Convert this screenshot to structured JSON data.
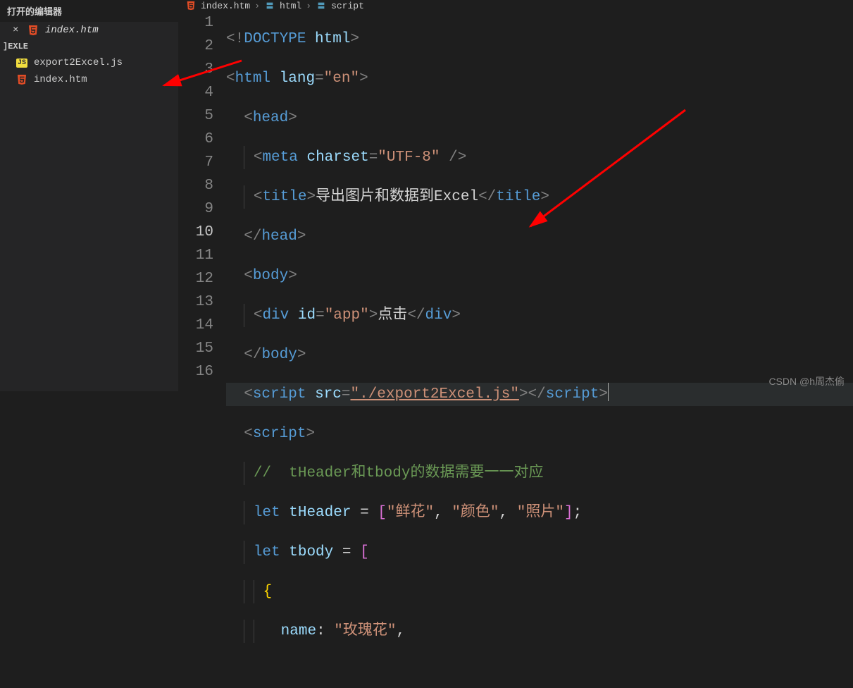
{
  "sidebar": {
    "open_editors_header": "打开的编辑器",
    "open_file": {
      "label": "index.htm"
    },
    "workspace": "]EXLE",
    "files": [
      {
        "icon": "js",
        "label": "export2Excel.js"
      },
      {
        "icon": "html5",
        "label": "index.htm"
      }
    ]
  },
  "breadcrumb": {
    "items": [
      {
        "icon": "html5",
        "label": "index.htm"
      },
      {
        "icon": "block",
        "label": "html"
      },
      {
        "icon": "block",
        "label": "script"
      }
    ]
  },
  "editor": {
    "active_line": 10,
    "line_numbers": [
      "1",
      "2",
      "3",
      "4",
      "5",
      "6",
      "7",
      "8",
      "9",
      "10",
      "11",
      "12",
      "13",
      "14",
      "15",
      "16"
    ],
    "code": {
      "l1": {
        "doctype": "DOCTYPE",
        "html": "html"
      },
      "l2": {
        "tag": "html",
        "attr": "lang",
        "val": "\"en\""
      },
      "l3": {
        "tag": "head"
      },
      "l4": {
        "tag": "meta",
        "attr": "charset",
        "val": "\"UTF-8\""
      },
      "l5": {
        "tag": "title",
        "text": "导出图片和数据到Excel"
      },
      "l6": {
        "tag": "head"
      },
      "l7": {
        "tag": "body"
      },
      "l8": {
        "tag": "div",
        "attr": "id",
        "val": "\"app\"",
        "text": "点击"
      },
      "l9": {
        "tag": "body"
      },
      "l10": {
        "tag": "script",
        "attr": "src",
        "val": "\"./export2Excel.js\""
      },
      "l11": {
        "tag": "script"
      },
      "l12": {
        "comment": "//  tHeader和tbody的数据需要一一对应"
      },
      "l13": {
        "kw": "let",
        "var": "tHeader",
        "v1": "\"鲜花\"",
        "v2": "\"颜色\"",
        "v3": "\"照片\""
      },
      "l14": {
        "kw": "let",
        "var": "tbody"
      },
      "l16": {
        "prop": "name",
        "val": "\"玫瑰花\""
      }
    }
  },
  "watermark": "CSDN @h周杰偷"
}
